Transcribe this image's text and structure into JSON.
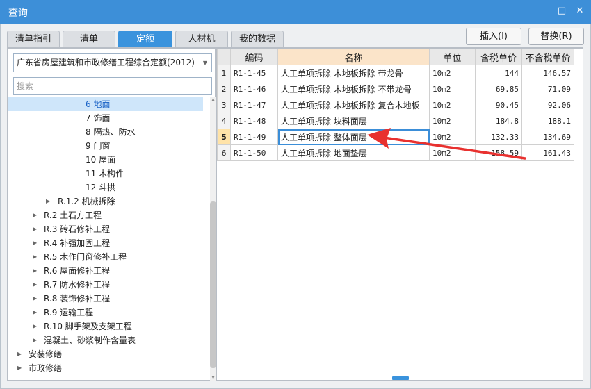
{
  "window": {
    "title": "查询"
  },
  "tabs": [
    {
      "label": "清单指引",
      "active": false
    },
    {
      "label": "清单",
      "active": false
    },
    {
      "label": "定额",
      "active": true
    },
    {
      "label": "人材机",
      "active": false
    },
    {
      "label": "我的数据",
      "active": false
    }
  ],
  "actions": {
    "insert_label": "插入(I)",
    "replace_label": "替换(R)"
  },
  "left": {
    "quota_set_value": "广东省房屋建筑和市政修缮工程综合定额(2012)",
    "search_placeholder": "搜索",
    "tree": [
      {
        "label": "6 地面",
        "selected": true,
        "arrow": false
      },
      {
        "label": "7 饰面",
        "selected": false,
        "arrow": false
      },
      {
        "label": "8 隔热、防水",
        "selected": false,
        "arrow": false
      },
      {
        "label": "9 门窗",
        "selected": false,
        "arrow": false
      },
      {
        "label": "10 屋面",
        "selected": false,
        "arrow": false
      },
      {
        "label": "11 木构件",
        "selected": false,
        "arrow": false
      },
      {
        "label": "12 斗拱",
        "selected": false,
        "arrow": false
      },
      {
        "label": "R.1.2 机械拆除",
        "selected": false,
        "arrow": true
      },
      {
        "label": "R.2 土石方工程",
        "selected": false,
        "arrow": true
      },
      {
        "label": "R.3 砖石修补工程",
        "selected": false,
        "arrow": true
      },
      {
        "label": "R.4 补强加固工程",
        "selected": false,
        "arrow": true
      },
      {
        "label": "R.5 木作门窗修补工程",
        "selected": false,
        "arrow": true
      },
      {
        "label": "R.6 屋面修补工程",
        "selected": false,
        "arrow": true
      },
      {
        "label": "R.7 防水修补工程",
        "selected": false,
        "arrow": true
      },
      {
        "label": "R.8 装饰修补工程",
        "selected": false,
        "arrow": true
      },
      {
        "label": "R.9 运输工程",
        "selected": false,
        "arrow": true
      },
      {
        "label": "R.10 脚手架及支架工程",
        "selected": false,
        "arrow": true
      },
      {
        "label": "混凝土、砂浆制作含量表",
        "selected": false,
        "arrow": true
      },
      {
        "label": "安装修缮",
        "selected": false,
        "arrow": true
      },
      {
        "label": "市政修缮",
        "selected": false,
        "arrow": true
      }
    ]
  },
  "grid": {
    "headers": {
      "code": "编码",
      "name": "名称",
      "unit": "单位",
      "price_tax": "含税单价",
      "price_notax": "不含税单价"
    },
    "rows": [
      {
        "no": "1",
        "code": "R1-1-45",
        "name": "人工单项拆除 木地板拆除 带龙骨",
        "unit": "10m2",
        "price_tax": "144",
        "price_notax": "146.57"
      },
      {
        "no": "2",
        "code": "R1-1-46",
        "name": "人工单项拆除 木地板拆除 不带龙骨",
        "unit": "10m2",
        "price_tax": "69.85",
        "price_notax": "71.09"
      },
      {
        "no": "3",
        "code": "R1-1-47",
        "name": "人工单项拆除 木地板拆除 复合木地板",
        "unit": "10m2",
        "price_tax": "90.45",
        "price_notax": "92.06"
      },
      {
        "no": "4",
        "code": "R1-1-48",
        "name": "人工单项拆除 块料面层",
        "unit": "10m2",
        "price_tax": "184.8",
        "price_notax": "188.1"
      },
      {
        "no": "5",
        "code": "R1-1-49",
        "name": "人工单项拆除 整体面层",
        "unit": "10m2",
        "price_tax": "132.33",
        "price_notax": "134.69"
      },
      {
        "no": "6",
        "code": "R1-1-50",
        "name": "人工单项拆除 地面垫层",
        "unit": "10m2",
        "price_tax": "158.59",
        "price_notax": "161.43"
      }
    ],
    "current_row": 5
  },
  "colors": {
    "titlebar": "#3d8fd8",
    "active_tab": "#3a93dd",
    "annotation_arrow": "#e8312f"
  }
}
